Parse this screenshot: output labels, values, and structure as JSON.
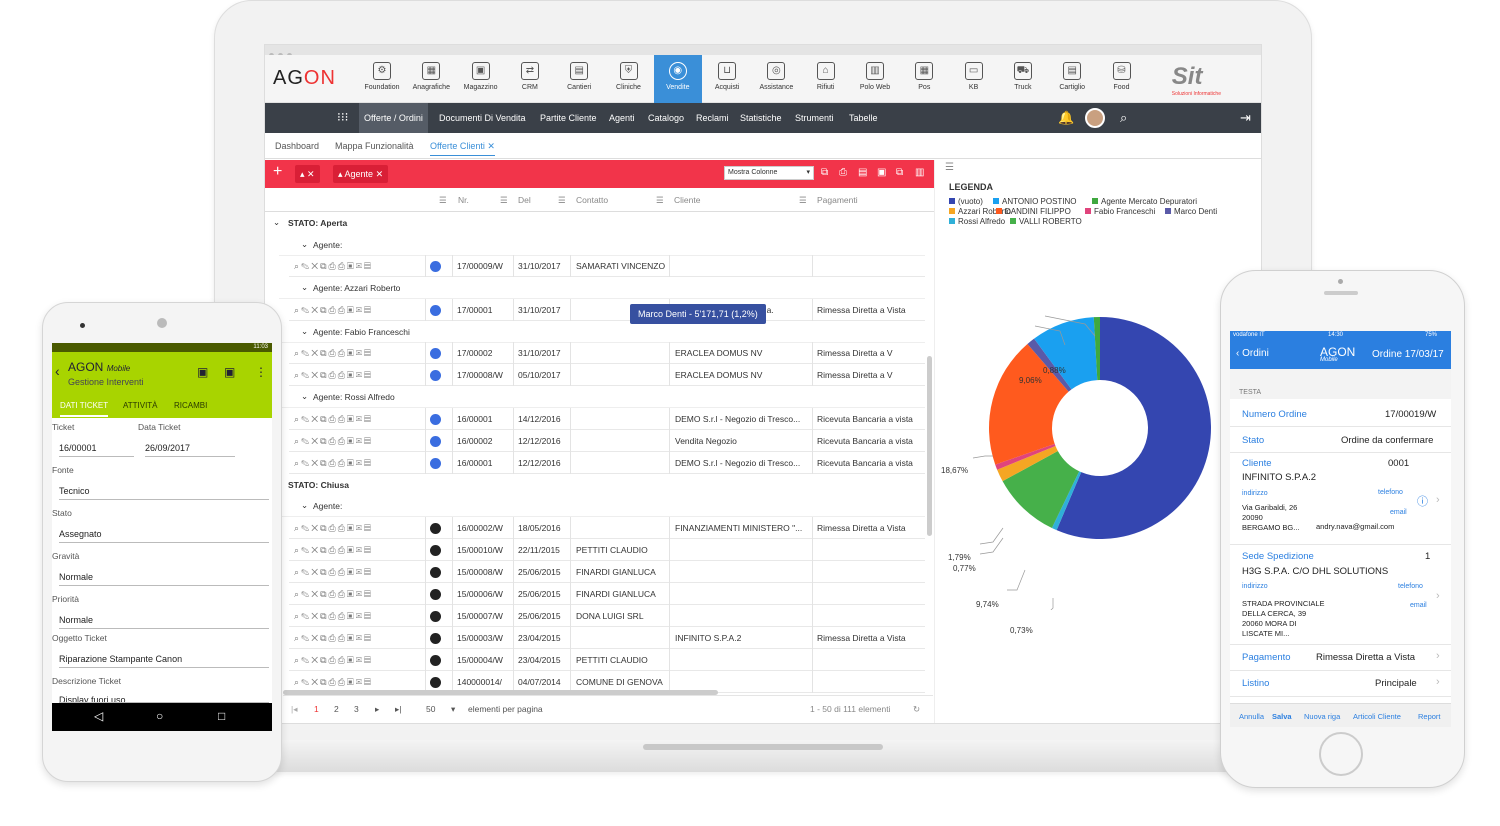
{
  "desktop": {
    "logo": "AG",
    "logo2": "ON",
    "modules": [
      "Foundation",
      "Anagrafiche",
      "Magazzino",
      "CRM",
      "Cantieri",
      "Cliniche",
      "Vendite",
      "Acquisti",
      "Assistance",
      "Rifiuti",
      "Polo Web",
      "Pos",
      "KB",
      "Truck",
      "Cartiglio",
      "Food"
    ],
    "active_module": "Vendite",
    "brand": "Sit",
    "brand_sub": "Soluzioni Informatiche",
    "nav": [
      "Offerte / Ordini",
      "Documenti Di Vendita",
      "Partite Cliente",
      "Agenti",
      "Catalogo",
      "Reclami",
      "Statistiche",
      "Strumenti",
      "Tabelle"
    ],
    "tabs": [
      "Dashboard",
      "Mappa Funzionalità",
      "Offerte Clienti"
    ],
    "filter_pill": "Agente",
    "columns_select": "Mostra Colonne",
    "grid_headers": [
      "Nr.",
      "Del",
      "Contatto",
      "Cliente",
      "Pagamenti"
    ],
    "rows": [
      {
        "kind": "stato",
        "text": "STATO: Aperta"
      },
      {
        "kind": "agente",
        "text": "Agente:"
      },
      {
        "kind": "data",
        "color": "#3a6de0",
        "nr": "17/00009/W",
        "del": "31/10/2017",
        "contatto": "SAMARATI VINCENZO",
        "cliente": "",
        "pag": ""
      },
      {
        "kind": "agente",
        "text": "Agente: Azzari Roberto"
      },
      {
        "kind": "data",
        "color": "#3a6de0",
        "nr": "17/00001",
        "del": "31/10/2017",
        "contatto": "",
        "cliente": "Cotonificio di Albino S.p.a.",
        "pag": "Rimessa Diretta a Vista"
      },
      {
        "kind": "agente",
        "text": "Agente: Fabio Franceschi"
      },
      {
        "kind": "data",
        "color": "#3a6de0",
        "nr": "17/00002",
        "del": "31/10/2017",
        "contatto": "",
        "cliente": "ERACLEA DOMUS NV",
        "pag": "Rimessa Diretta a V"
      },
      {
        "kind": "data",
        "color": "#3a6de0",
        "nr": "17/00008/W",
        "del": "05/10/2017",
        "contatto": "",
        "cliente": "ERACLEA DOMUS NV",
        "pag": "Rimessa Diretta a V"
      },
      {
        "kind": "agente",
        "text": "Agente: Rossi Alfredo"
      },
      {
        "kind": "data",
        "color": "#3a6de0",
        "nr": "16/00001",
        "del": "14/12/2016",
        "contatto": "",
        "cliente": "DEMO S.r.l - Negozio di Tresco...",
        "pag": "Ricevuta Bancaria a vista"
      },
      {
        "kind": "data",
        "color": "#3a6de0",
        "nr": "16/00002",
        "del": "12/12/2016",
        "contatto": "",
        "cliente": "Vendita Negozio",
        "pag": "Ricevuta Bancaria a vista"
      },
      {
        "kind": "data",
        "color": "#3a6de0",
        "nr": "16/00001",
        "del": "12/12/2016",
        "contatto": "",
        "cliente": "DEMO S.r.l - Negozio di Tresco...",
        "pag": "Ricevuta Bancaria a vista"
      },
      {
        "kind": "stato",
        "text": "STATO: Chiusa"
      },
      {
        "kind": "agente",
        "text": "Agente:"
      },
      {
        "kind": "data",
        "color": "#222",
        "nr": "16/00002/W",
        "del": "18/05/2016",
        "contatto": "",
        "cliente": "FINANZIAMENTI MINISTERO \"...",
        "pag": "Rimessa Diretta a Vista"
      },
      {
        "kind": "data",
        "color": "#222",
        "nr": "15/00010/W",
        "del": "22/11/2015",
        "contatto": "PETTITI CLAUDIO",
        "cliente": "",
        "pag": ""
      },
      {
        "kind": "data",
        "color": "#222",
        "nr": "15/00008/W",
        "del": "25/06/2015",
        "contatto": "FINARDI GIANLUCA",
        "cliente": "",
        "pag": ""
      },
      {
        "kind": "data",
        "color": "#222",
        "nr": "15/00006/W",
        "del": "25/06/2015",
        "contatto": "FINARDI GIANLUCA",
        "cliente": "",
        "pag": ""
      },
      {
        "kind": "data",
        "color": "#222",
        "nr": "15/00007/W",
        "del": "25/06/2015",
        "contatto": "DONA LUIGI SRL",
        "cliente": "",
        "pag": ""
      },
      {
        "kind": "data",
        "color": "#222",
        "nr": "15/00003/W",
        "del": "23/04/2015",
        "contatto": "",
        "cliente": "INFINITO S.P.A.2",
        "pag": "Rimessa Diretta a Vista"
      },
      {
        "kind": "data",
        "color": "#222",
        "nr": "15/00004/W",
        "del": "23/04/2015",
        "contatto": "PETTITI CLAUDIO",
        "cliente": "",
        "pag": ""
      },
      {
        "kind": "data",
        "color": "#222",
        "nr": "140000014/",
        "del": "04/07/2014",
        "contatto": "COMUNE DI GENOVA",
        "cliente": "",
        "pag": ""
      }
    ],
    "pager": {
      "pages": [
        "1",
        "2",
        "3"
      ],
      "current": "1",
      "page_size": "50",
      "page_size_label": "elementi per pagina",
      "summary": "1 - 50 di 111 elementi"
    },
    "tooltip": "Marco Denti - 5'171,71 (1,2%)"
  },
  "chart_data": {
    "type": "pie",
    "title": "LEGENDA",
    "series": [
      {
        "name": "(vuoto)",
        "color": "#3446b0",
        "value": 55.4
      },
      {
        "name": "ANTONIO POSTINO",
        "color": "#1aa0f0",
        "value": 9.06
      },
      {
        "name": "Agente Mercato Depuratori",
        "color": "#3fa83f",
        "value": 0.88
      },
      {
        "name": "Azzari Roberto",
        "color": "#f5a623",
        "value": 1.79
      },
      {
        "name": "DANDINI FILIPPO",
        "color": "#ff5a1e",
        "value": 18.67
      },
      {
        "name": "Fabio Franceschi",
        "color": "#e0447c",
        "value": 0.77
      },
      {
        "name": "Marco Denti",
        "color": "#5a5aa8",
        "value": 1.2
      },
      {
        "name": "Rossi Alfredo",
        "color": "#2fb0d8",
        "value": 0.73
      },
      {
        "name": "VALLI ROBERTO",
        "color": "#46b04a",
        "value": 9.74
      }
    ],
    "labels": [
      "0,88%",
      "9,06%",
      "18,67%",
      "1,79%",
      "0,77%",
      "9,74%",
      "0,73%"
    ]
  },
  "android": {
    "status_time": "11:03",
    "brand": "AGON",
    "brand_sub": "Mobile",
    "title": "Gestione Interventi",
    "tabs": [
      "DATI TICKET",
      "ATTIVITÀ",
      "RICAMBI"
    ],
    "fields": {
      "ticket_label": "Ticket",
      "ticket": "16/00001",
      "data_label": "Data Ticket",
      "data": "26/09/2017",
      "fonte_label": "Fonte",
      "fonte": "Tecnico",
      "stato_label": "Stato",
      "stato": "Assegnato",
      "gravita_label": "Gravità",
      "gravita": "Normale",
      "priorita_label": "Priorità",
      "priorita": "Normale",
      "oggetto_label": "Oggetto Ticket",
      "oggetto": "Riparazione Stampante Canon",
      "descr_label": "Descrizione Ticket",
      "descr": "Display fuori uso"
    }
  },
  "iphone": {
    "carrier": "vodafone IT",
    "time": "14:30",
    "battery": "75%",
    "back": "Ordini",
    "brand": "AGON",
    "brand_sub": "Mobile",
    "title": "Ordine 17/03/17",
    "section": "TESTA",
    "numero_label": "Numero Ordine",
    "numero": "17/00019/W",
    "stato_label": "Stato",
    "stato": "Ordine da confermare",
    "cliente_label": "Cliente",
    "cliente_code": "0001",
    "cliente": "INFINITO S.P.A.2",
    "indirizzo_label": "indirizzo",
    "telefono_label": "telefono",
    "email_label": "email",
    "indirizzo": "Via Garibaldi, 26",
    "cap": "20090",
    "citta": "BERGAMO BG...",
    "email": "andry.nava@gmail.com",
    "sped_label": "Sede Spedizione",
    "sped_code": "1",
    "sped": "H3G S.P.A. C/O DHL SOLUTIONS",
    "sped_addr1": "STRADA PROVINCIALE",
    "sped_addr2": "DELLA CERCA, 39",
    "sped_addr3": "20060 MORA DI",
    "sped_addr4": "LISCATE MI...",
    "pag_label": "Pagamento",
    "pag": "Rimessa Diretta a Vista",
    "listino_label": "Listino",
    "listino": "Principale",
    "footer": [
      "Annulla",
      "Salva",
      "Nuova riga",
      "Articoli Cliente",
      "Report"
    ]
  }
}
